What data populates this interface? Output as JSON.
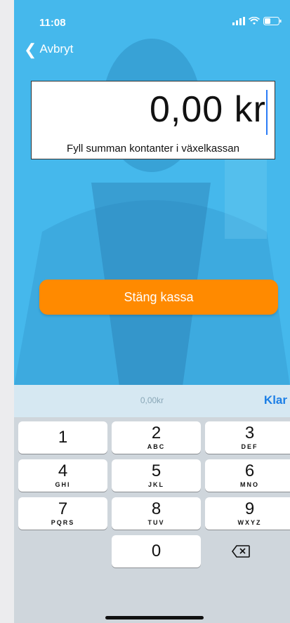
{
  "status": {
    "time": "11:08"
  },
  "nav": {
    "back_label": "Avbryt"
  },
  "amount": {
    "value": "0,00 kr",
    "hint": "Fyll summan kontanter i växelkassan"
  },
  "actions": {
    "close_register": "Stäng kassa"
  },
  "accessory": {
    "preview": "0,00kr",
    "done": "Klar"
  },
  "keypad": {
    "keys": [
      {
        "num": "1",
        "letters": ""
      },
      {
        "num": "2",
        "letters": "ABC"
      },
      {
        "num": "3",
        "letters": "DEF"
      },
      {
        "num": "4",
        "letters": "GHI"
      },
      {
        "num": "5",
        "letters": "JKL"
      },
      {
        "num": "6",
        "letters": "MNO"
      },
      {
        "num": "7",
        "letters": "PQRS"
      },
      {
        "num": "8",
        "letters": "TUV"
      },
      {
        "num": "9",
        "letters": "WXYZ"
      },
      {
        "num": "0",
        "letters": ""
      }
    ]
  },
  "colors": {
    "accent": "#ff8a00",
    "background": "#3fb4ea",
    "link": "#1d7fe6"
  }
}
